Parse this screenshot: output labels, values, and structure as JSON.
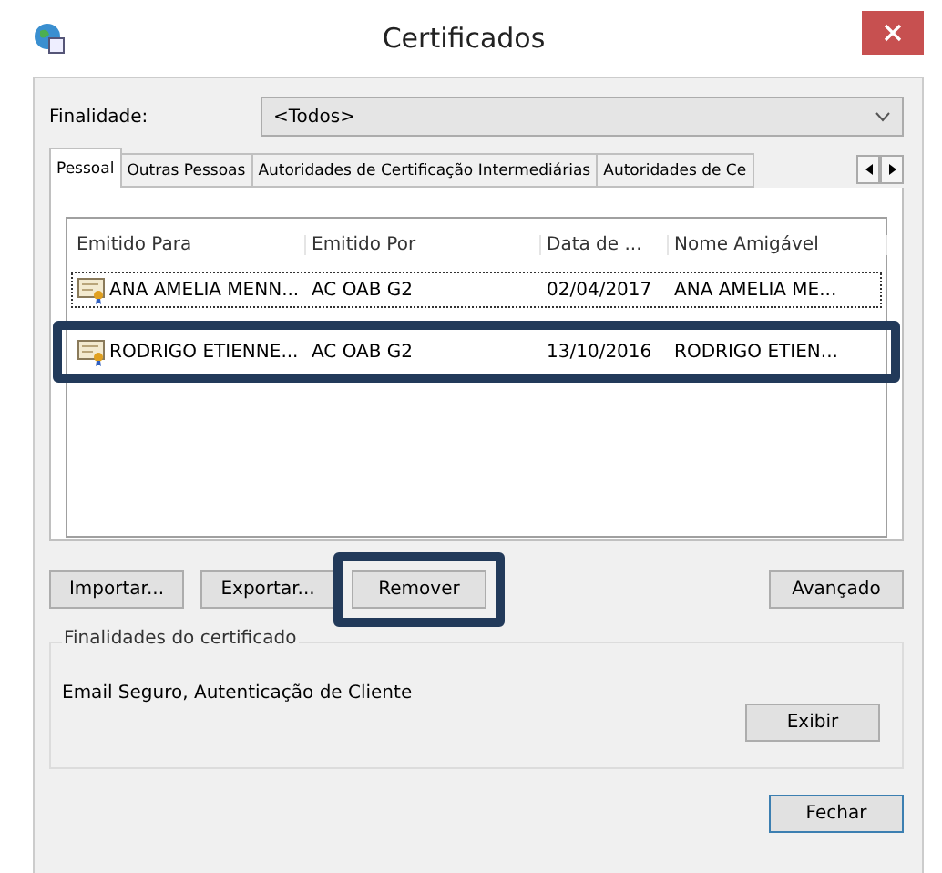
{
  "window": {
    "title": "Certificados"
  },
  "purpose": {
    "label": "Finalidade:",
    "value": "<Todos>"
  },
  "tabs": [
    {
      "label": "Pessoal",
      "selected": true
    },
    {
      "label": "Outras Pessoas",
      "selected": false
    },
    {
      "label": "Autoridades de Certificação Intermediárias",
      "selected": false
    },
    {
      "label": "Autoridades de Ce",
      "selected": false
    }
  ],
  "table": {
    "columns": [
      "Emitido Para",
      "Emitido Por",
      "Data de ...",
      "Nome Amigável"
    ],
    "rows": [
      {
        "cells": [
          "ANA AMELIA MENN...",
          "AC OAB G2",
          "02/04/2017",
          "ANA AMELIA ME..."
        ],
        "focused": true,
        "highlighted": false
      },
      {
        "cells": [
          "RODRIGO ETIENNE...",
          "AC OAB G2",
          "13/10/2016",
          "RODRIGO ETIEN..."
        ],
        "focused": false,
        "highlighted": true
      }
    ]
  },
  "actions": [
    {
      "label": "Importar...",
      "highlighted": false
    },
    {
      "label": "Exportar...",
      "highlighted": false
    },
    {
      "label": "Remover",
      "highlighted": true
    }
  ],
  "advanced": "Avançado",
  "group": {
    "title": "Finalidades do certificado",
    "text": "Email Seguro, Autenticação de Cliente",
    "button": "Exibir"
  },
  "close_button": "Fechar"
}
